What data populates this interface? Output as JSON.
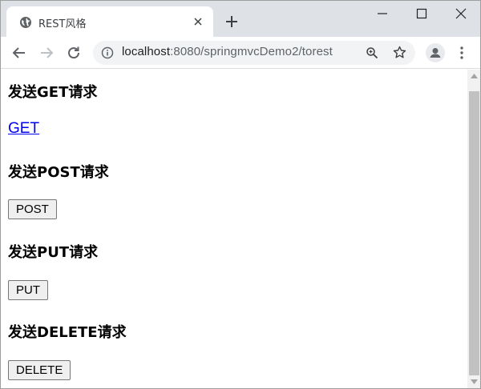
{
  "tab": {
    "icon": "globe-icon",
    "title": "REST风格"
  },
  "window_controls": [
    "minimize-icon",
    "maximize-icon",
    "close-icon"
  ],
  "toolbar": {
    "url_host": "localhost",
    "url_rest": ":8080/springmvcDemo2/torest"
  },
  "page": {
    "get_heading": "发送GET请求",
    "get_link": "GET",
    "post_heading": "发送POST请求",
    "post_button": "POST",
    "put_heading": "发送PUT请求",
    "put_button": "PUT",
    "delete_heading": "发送DELETE请求",
    "delete_button": "DELETE"
  },
  "colors": {
    "titlebar": "#dee1e6",
    "link": "#0000ee",
    "scroll_thumb": "#c1c1c1"
  }
}
